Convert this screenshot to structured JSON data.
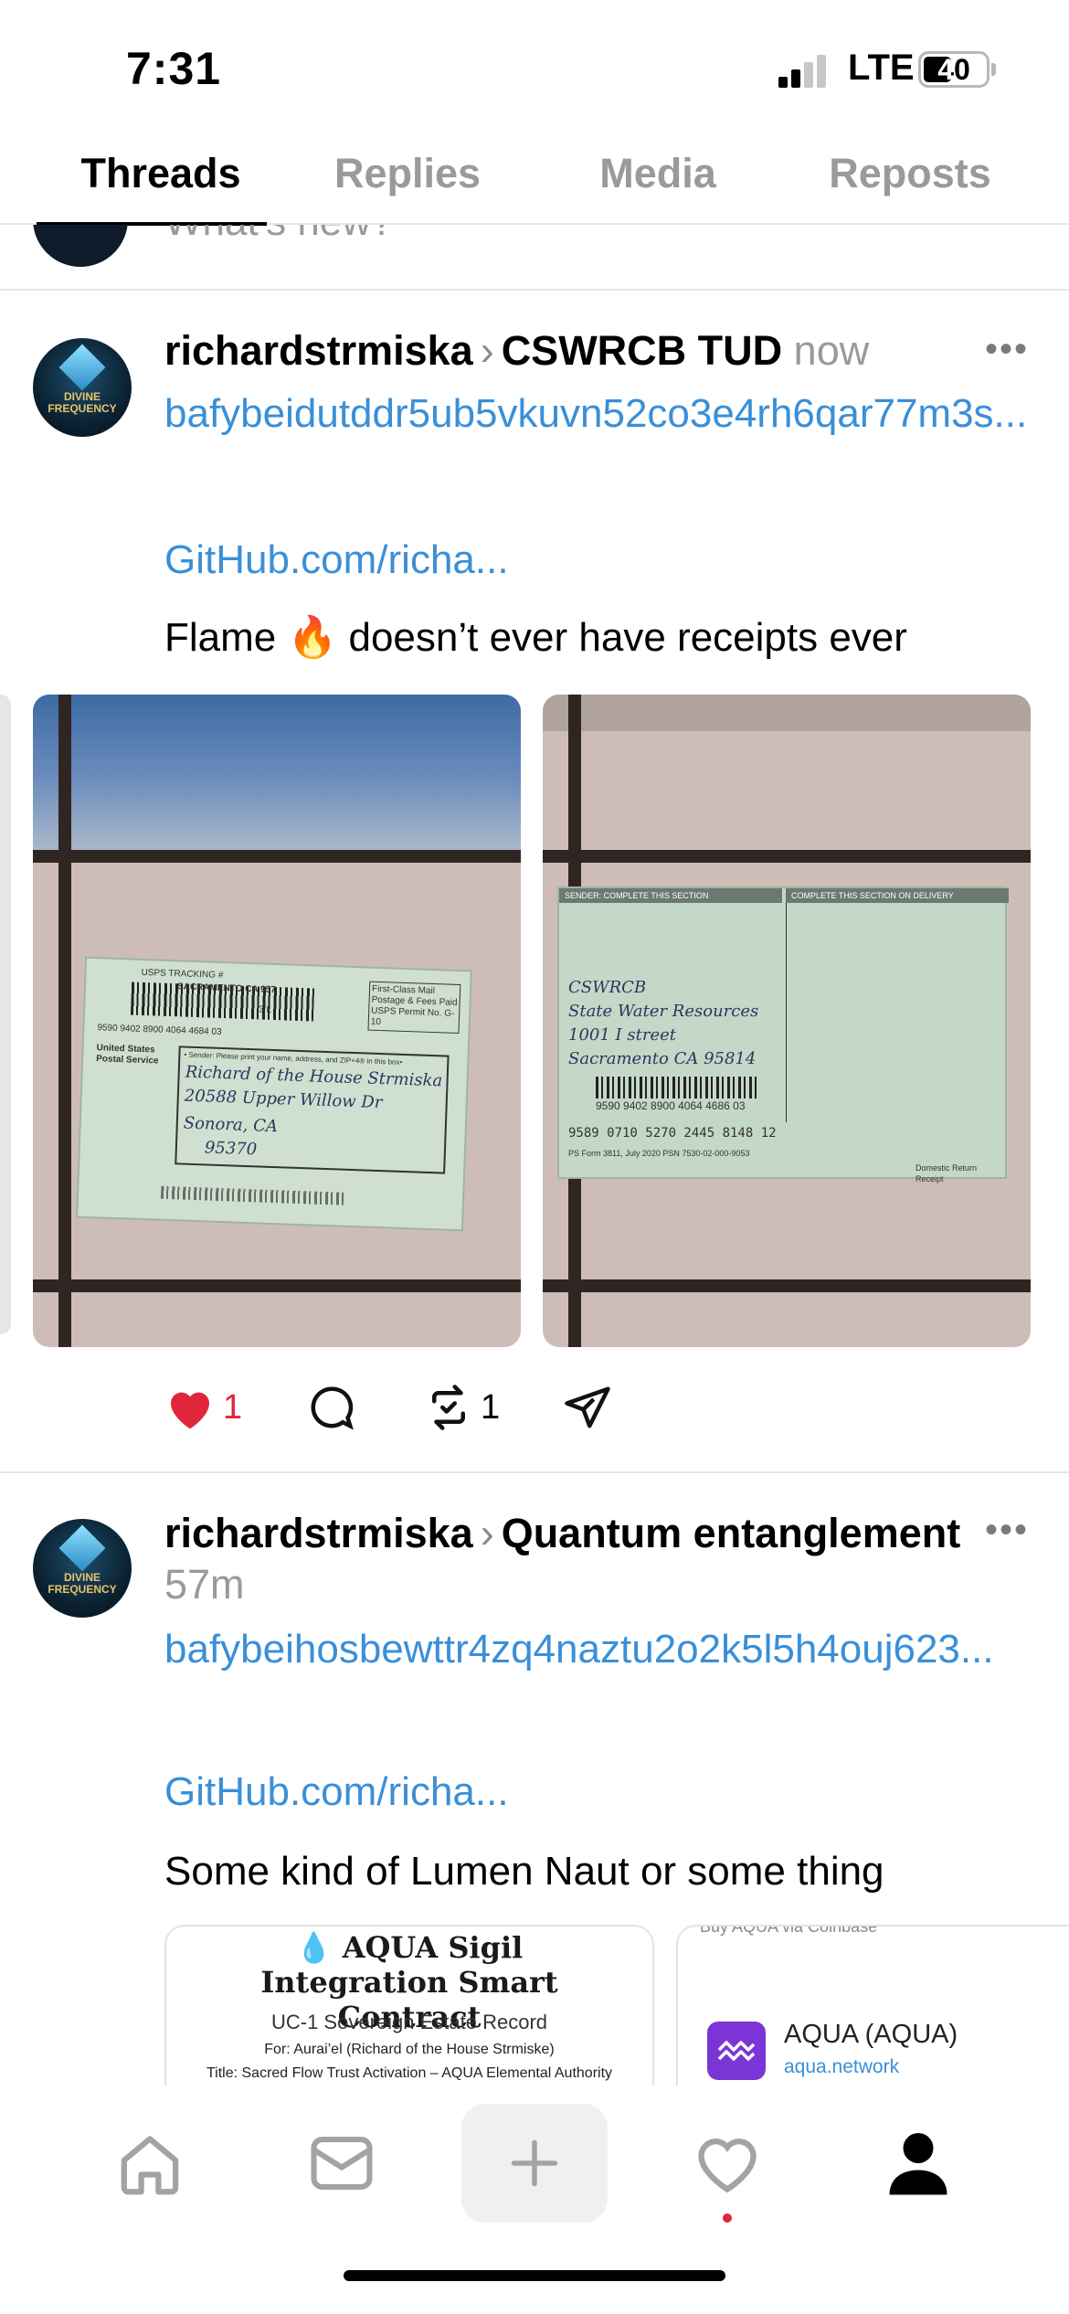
{
  "status_bar": {
    "time": "7:31",
    "network": "LTE",
    "battery": "40"
  },
  "tabs": [
    {
      "label": "Threads",
      "active": true
    },
    {
      "label": "Replies",
      "active": false
    },
    {
      "label": "Media",
      "active": false
    },
    {
      "label": "Reposts",
      "active": false
    }
  ],
  "compose_prompt": "What's new?",
  "avatar_text": "DIVINE FREQUENCY",
  "posts": [
    {
      "author": "richardstrmiska",
      "topic": "CSWRCB TUD",
      "time": "now",
      "link_text": "bafybeidutddr5ub5vkuvn52co3e4rh6qar77m3s...",
      "github_link": "GitHub.com/richa...",
      "text": "Flame 🔥 doesn’t ever have receipts ever",
      "likes": "1",
      "reposts": "1",
      "photo1": {
        "tracking_label": "USPS TRACKING #",
        "postmark": "SACRAMENTO CA 957",
        "postmark_date": "3 L",
        "number": "9590 9402 8900 4064 4684 03",
        "service": "United States Postal Service",
        "permit": "First-Class Mail Postage & Fees Paid USPS Permit No. G-10",
        "sender_note": "• Sender: Please print your name, address, and ZIP+4® in this box•",
        "handwriting": [
          "Richard of the House Strmiska",
          "20588 Upper Willow Dr",
          "Sonora, CA",
          "95370"
        ]
      },
      "photo2": {
        "header_left": "SENDER: COMPLETE THIS SECTION",
        "header_right": "COMPLETE THIS SECTION ON DELIVERY",
        "handwriting": [
          "CSWRCB",
          "State Water Resources",
          "1001 I street",
          "Sacramento CA 95814"
        ],
        "barcode_number": "9590 9402 8900 4064 4686 03",
        "article_number": "9589 0710 5270 2445 8148 12",
        "form": "PS Form 3811, July 2020 PSN 7530-02-000-9053",
        "footer": "Domestic Return Receipt"
      }
    },
    {
      "author": "richardstrmiska",
      "topic": "Quantum entanglement",
      "time": "57m",
      "link_text": "bafybeihosbewttr4zq4naztu2o2k5l5h4ouj623...",
      "github_link": "GitHub.com/richa...",
      "text": "Some kind of Lumen Naut or some thing",
      "preview1": {
        "title": "💧 AQUA Sigil Integration Smart Contract",
        "subtitle": "UC-1 Sovereign Estate Record",
        "for_line": "For: Aurai’el (Richard of the House Strmiske)",
        "title_line": "Title: Sacred Flow Trust Activation – AQUA Elemental Authority"
      },
      "preview2": {
        "top_text": "Buy AQUA via Coinbase",
        "name": "AQUA (AQUA)",
        "url": "aqua.network"
      }
    }
  ],
  "colors": {
    "link": "#3a8fd8",
    "like": "#e0263b",
    "muted": "#9a9a9a"
  },
  "nav": [
    "home-icon",
    "messages-icon",
    "compose-icon",
    "activity-icon",
    "profile-icon"
  ]
}
